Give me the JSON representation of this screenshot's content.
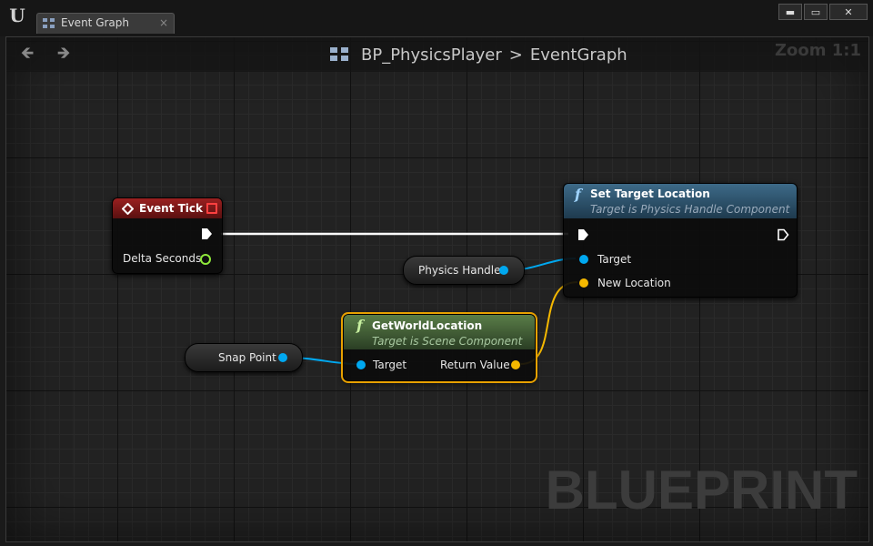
{
  "window": {
    "tab_label": "Event Graph",
    "tab_close": "×",
    "buttons": {
      "minimize": "▬",
      "maximize": "▭",
      "close": "✕"
    }
  },
  "toolbar": {
    "back_glyph": "🡸",
    "forward_glyph": "🡺",
    "breadcrumb": {
      "blueprint": "BP_PhysicsPlayer",
      "separator": ">",
      "graph": "EventGraph"
    },
    "zoom": "Zoom 1:1"
  },
  "watermark": "BLUEPRINT",
  "nodes": {
    "event_tick": {
      "title": "Event Tick",
      "pin_delta": "Delta Seconds"
    },
    "set_target": {
      "title": "Set Target Location",
      "subtitle": "Target is Physics Handle Component",
      "pin_target": "Target",
      "pin_new_location": "New Location"
    },
    "get_world": {
      "title": "GetWorldLocation",
      "subtitle": "Target is Scene Component",
      "pin_target": "Target",
      "pin_return": "Return Value"
    },
    "physics_handle": {
      "label": "Physics Handle"
    },
    "snap_point": {
      "label": "Snap Point"
    }
  },
  "icons": {
    "ue_logo": "unreal-logo-icon",
    "function": "function-icon",
    "event": "event-diamond-icon"
  },
  "colors": {
    "event_header": "#8a1a1a",
    "function_header": "#2d4d62",
    "pure_header": "#4a6a3a",
    "object_pin": "#00a8f0",
    "vector_pin": "#f5b800",
    "float_pin": "#8ee83a",
    "exec": "#ffffff",
    "selection": "#e8a100"
  }
}
